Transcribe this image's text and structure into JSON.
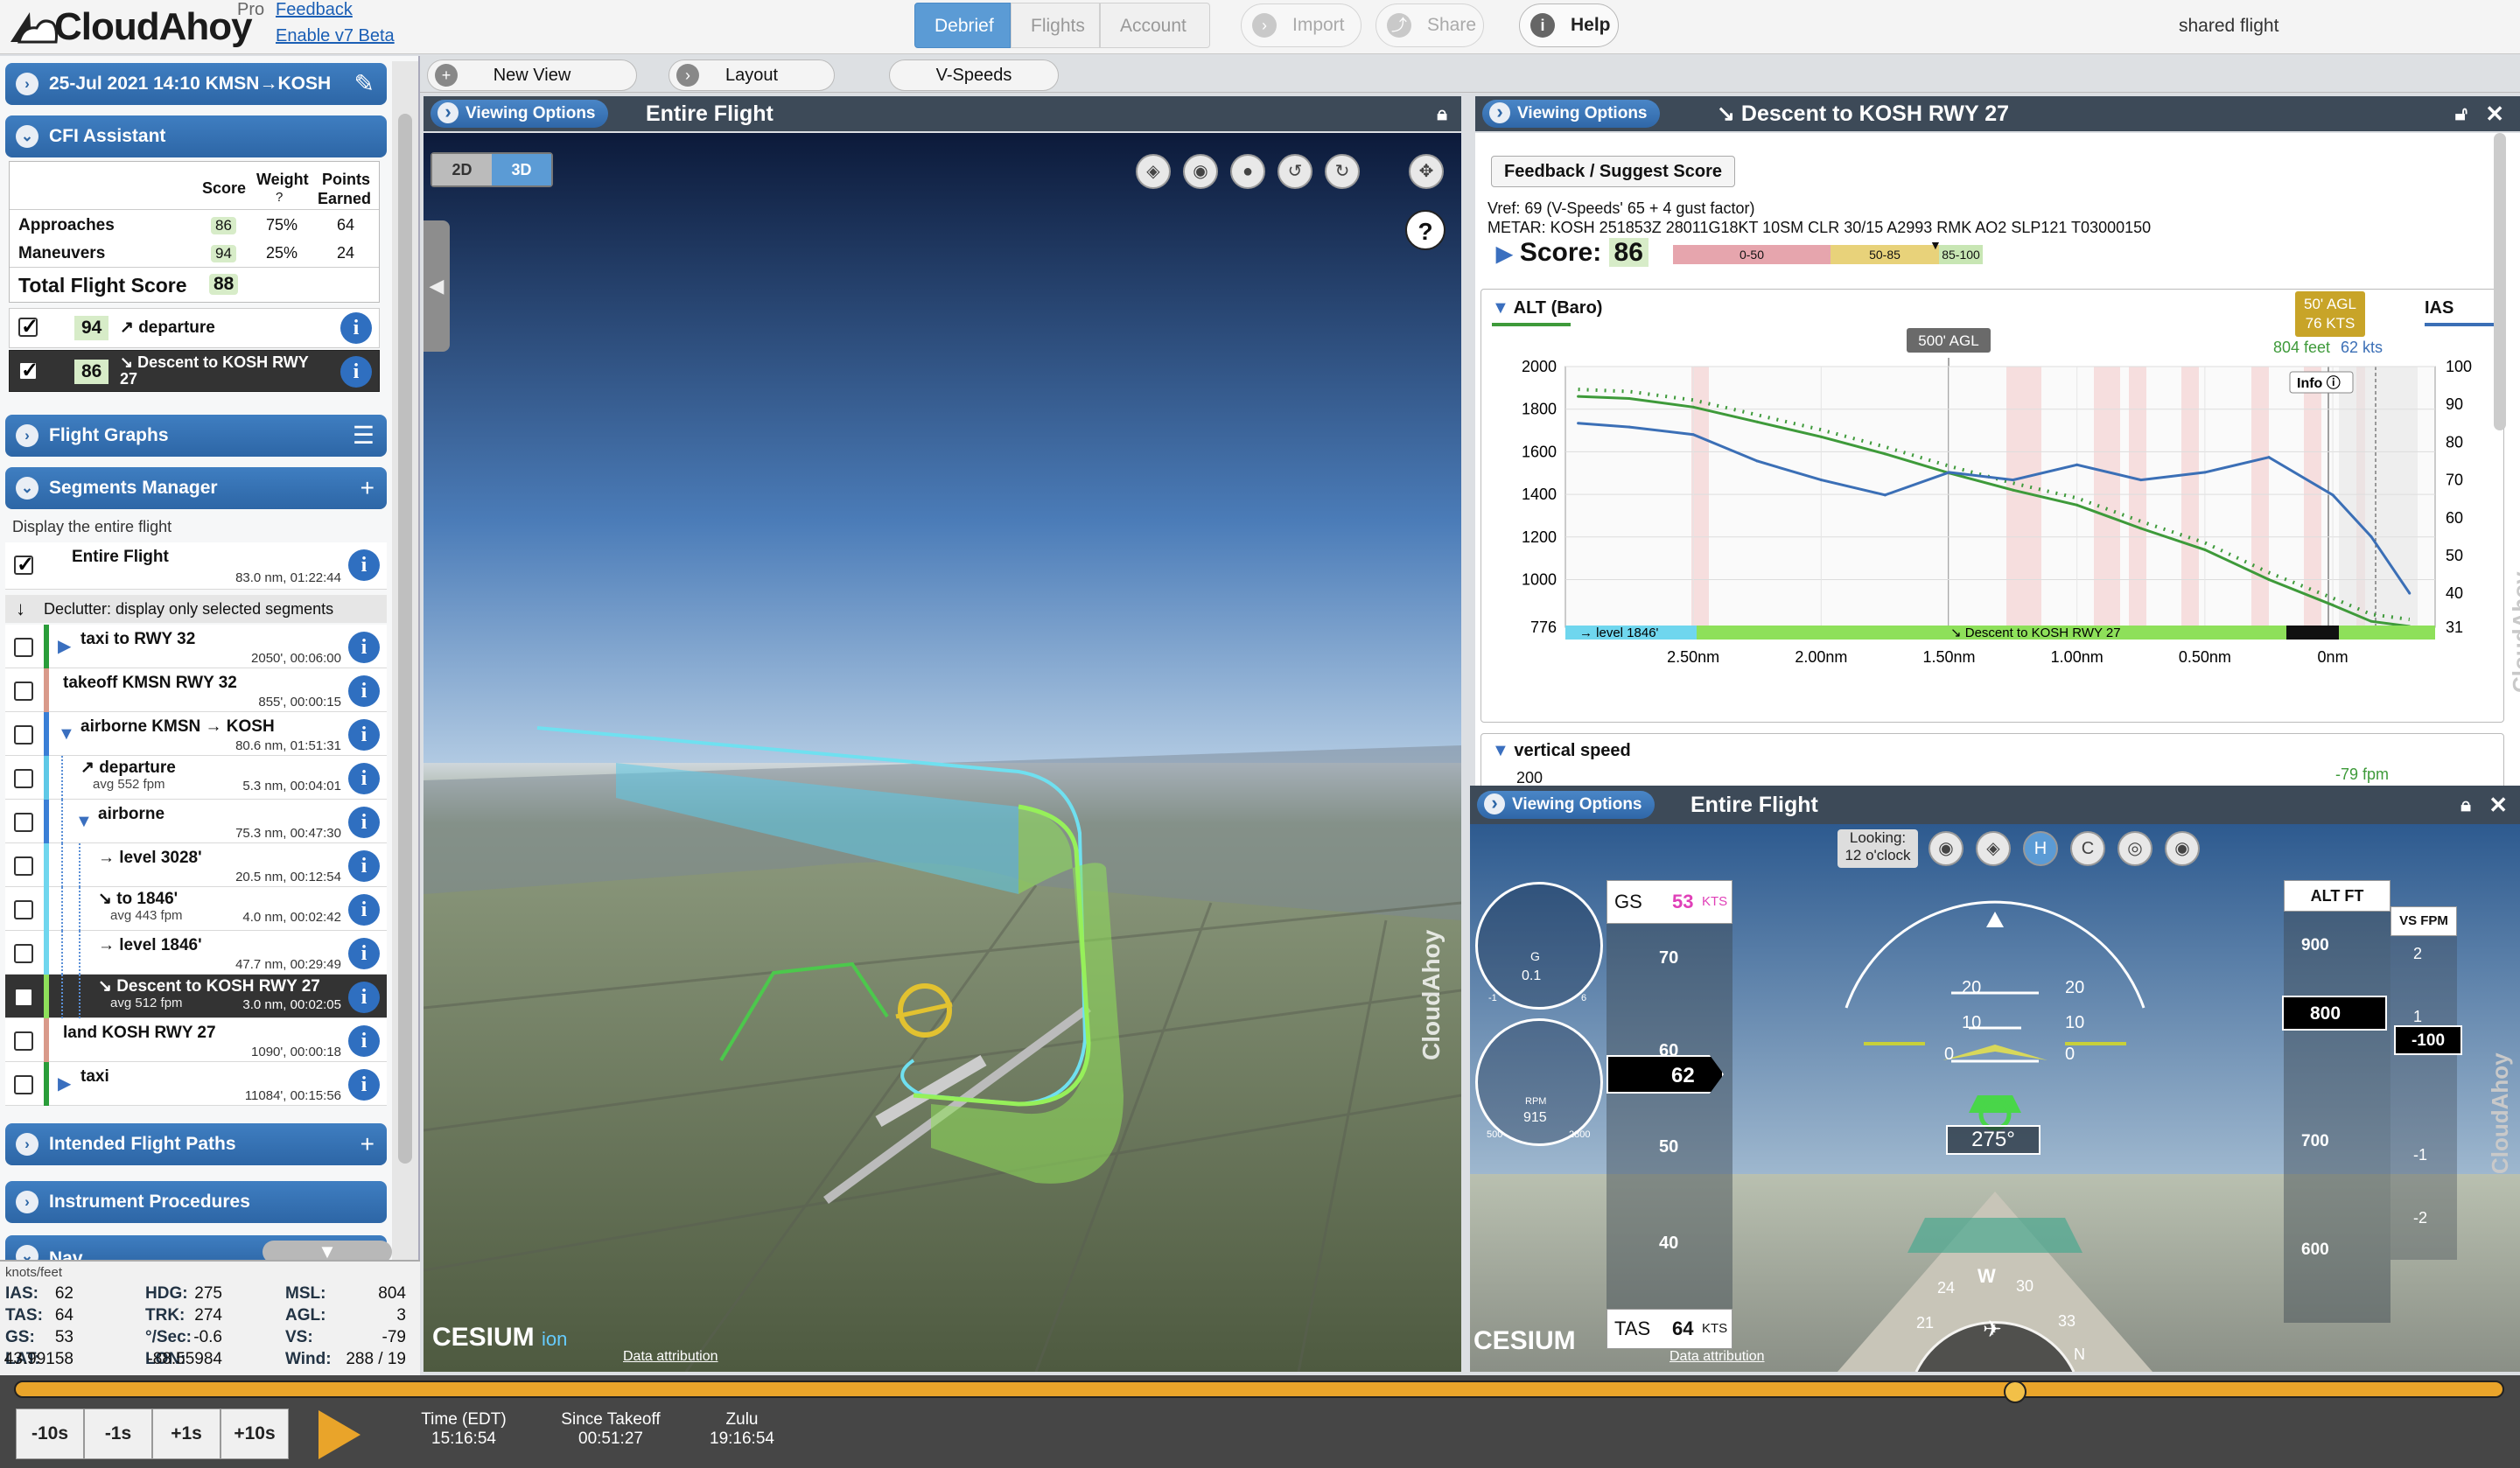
{
  "topbar": {
    "logo": "CloudAhoy",
    "pro": "Pro",
    "feedback": "Feedback",
    "beta": "Enable v7 Beta",
    "tabs": [
      "Debrief",
      "Flights",
      "Account"
    ],
    "import": "Import",
    "share": "Share",
    "help": "Help",
    "shared": "shared flight"
  },
  "flight": {
    "title": "25-Jul 2021 14:10  KMSN→KOSH"
  },
  "cfi": {
    "title": "CFI Assistant",
    "h_score": "Score",
    "h_weight": "Weight",
    "h_points": "Points",
    "h_earned": "Earned",
    "rows": [
      {
        "name": "Approaches",
        "score": "86",
        "weight": "75%",
        "points": "64"
      },
      {
        "name": "Maneuvers",
        "score": "94",
        "weight": "25%",
        "points": "24"
      }
    ],
    "total_label": "Total Flight Score",
    "total": "88",
    "items": [
      {
        "score": "94",
        "label": "↗ departure"
      },
      {
        "score": "86",
        "label": "↘ Descent to KOSH RWY 27"
      }
    ]
  },
  "panels": {
    "graphs": "Flight Graphs",
    "segments": "Segments Manager",
    "display": "Display the entire flight",
    "entire": "Entire Flight",
    "entire_meta": "83.0 nm, 01:22:44",
    "declutter": "Declutter: display only selected segments",
    "intended": "Intended Flight Paths",
    "procedures": "Instrument Procedures",
    "nav": "Nav"
  },
  "segments": [
    {
      "name": "taxi to RWY 32",
      "sub": "",
      "meta": "2050', 00:06:00",
      "color": "#2a9d3a",
      "indent": 0,
      "tri": "▶"
    },
    {
      "name": "takeoff KMSN RWY 32",
      "sub": "",
      "meta": "855', 00:00:15",
      "color": "#d99a8a",
      "indent": 0,
      "tri": ""
    },
    {
      "name": "airborne KMSN → KOSH",
      "sub": "",
      "meta": "80.6 nm, 01:51:31",
      "color": "#3a7fd6",
      "indent": 0,
      "tri": "▼"
    },
    {
      "name": "↗ departure",
      "sub": "avg 552 fpm",
      "meta": "5.3 nm, 00:04:01",
      "color": "#5ec8e6",
      "indent": 1,
      "tri": ""
    },
    {
      "name": "airborne",
      "sub": "",
      "meta": "75.3 nm, 00:47:30",
      "color": "#3a7fd6",
      "indent": 1,
      "tri": "▼"
    },
    {
      "name": "→ level 3028'",
      "sub": "",
      "meta": "20.5 nm, 00:12:54",
      "color": "#6fd6ee",
      "indent": 2,
      "tri": ""
    },
    {
      "name": "↘ to 1846'",
      "sub": "avg 443 fpm",
      "meta": "4.0 nm, 00:02:42",
      "color": "#6fd6ee",
      "indent": 2,
      "tri": ""
    },
    {
      "name": "→ level 1846'",
      "sub": "",
      "meta": "47.7 nm, 00:29:49",
      "color": "#6fd6ee",
      "indent": 2,
      "tri": ""
    },
    {
      "name": "↘ Descent to KOSH RWY 27",
      "sub": "avg 512 fpm",
      "meta": "3.0 nm, 00:02:05",
      "color": "#8ee05a",
      "indent": 2,
      "tri": "",
      "dark": true
    },
    {
      "name": "land KOSH RWY 27",
      "sub": "",
      "meta": "1090', 00:00:18",
      "color": "#d99a8a",
      "indent": 0,
      "tri": ""
    },
    {
      "name": "taxi",
      "sub": "",
      "meta": "11084', 00:15:56",
      "color": "#2a9d3a",
      "indent": 0,
      "tri": "▶"
    }
  ],
  "nav": {
    "unit": "knots/feet",
    "rows": [
      [
        {
          "k": "IAS:",
          "v": "62"
        },
        {
          "k": "HDG:",
          "v": "275"
        },
        {
          "k": "MSL:",
          "v": "804"
        }
      ],
      [
        {
          "k": "TAS:",
          "v": "64"
        },
        {
          "k": "TRK:",
          "v": "274"
        },
        {
          "k": "AGL:",
          "v": "3"
        }
      ],
      [
        {
          "k": "GS:",
          "v": "53"
        },
        {
          "k": "°/Sec:",
          "v": "-0.6"
        },
        {
          "k": "VS:",
          "v": "-79"
        }
      ],
      [
        {
          "k": "LAT:",
          "v": "43.99158"
        },
        {
          "k": "LON:",
          "v": "-88.55984"
        },
        {
          "k": "Wind:",
          "v": "288 / 19"
        }
      ]
    ]
  },
  "viewtabs": {
    "newview": "New View",
    "layout": "Layout",
    "vspeeds": "V-Speeds"
  },
  "view3d": {
    "vo": "Viewing Options",
    "title": "Entire Flight",
    "d2": "2D",
    "d3": "3D",
    "help": "?",
    "cesium": "CESIUM",
    "ion": "ion",
    "attr": "Data attribution",
    "brand": "CloudAhoy"
  },
  "graph": {
    "vo": "Viewing Options",
    "title": "↘ Descent to KOSH RWY 27",
    "feedback": "Feedback / Suggest Score",
    "vref": "Vref: 69 (V-Speeds' 65 + 4 gust factor)",
    "metar": "METAR: KOSH 251853Z 28011G18KT 10SM CLR 30/15 A2993 RMK AO2 SLP121 T03000150",
    "score_label": "Score:",
    "score": "86",
    "bands": [
      "0-50",
      "50-85",
      "85-100"
    ],
    "alt_label": "ALT (Baro)",
    "ias_label": "IAS",
    "agl_tag": "500' AGL",
    "cursor_tag1": "50' AGL",
    "cursor_tag2": "76 KTS",
    "cursor_feet": "804 feet",
    "cursor_kts": "62 kts",
    "info": "Info",
    "seg1": "→ level 1846'",
    "seg2": "↘ Descent to KOSH RWY 27",
    "vs_label": "vertical speed",
    "vs_tick": "200",
    "vs_val": "-79 fpm",
    "brand": "CloudAhoy"
  },
  "chart_data": {
    "type": "line",
    "title": "ALT (Baro)",
    "xlabel": "",
    "ylabel": "",
    "x_ticks": [
      "2.50nm",
      "2.00nm",
      "1.50nm",
      "1.00nm",
      "0.50nm",
      "0nm"
    ],
    "y_ticks": [
      2000,
      1800,
      1600,
      1400,
      1200,
      1000,
      776
    ],
    "y2_ticks": [
      100,
      90,
      80,
      70,
      60,
      50,
      40,
      31
    ],
    "ylim": [
      776,
      2000
    ],
    "y2lim": [
      31,
      100
    ],
    "x": [
      2.95,
      2.75,
      2.5,
      2.25,
      2.0,
      1.75,
      1.5,
      1.25,
      1.0,
      0.75,
      0.5,
      0.25,
      0.0,
      -0.15,
      -0.3
    ],
    "series": [
      {
        "name": "ALT (Baro)",
        "color": "#3e9a3a",
        "axis": "left",
        "values": [
          1860,
          1850,
          1810,
          1740,
          1670,
          1590,
          1500,
          1420,
          1350,
          1240,
          1140,
          1000,
          880,
          804,
          780
        ]
      },
      {
        "name": "IAS",
        "color": "#3b6fb6",
        "axis": "right",
        "values": [
          85,
          84,
          82,
          75,
          70,
          66,
          72,
          70,
          74,
          70,
          72,
          76,
          66,
          55,
          40
        ]
      }
    ]
  },
  "pfd": {
    "vo": "Viewing Options",
    "title": "Entire Flight",
    "looking": "Looking:",
    "looking2": "12 o'clock",
    "gs_label": "GS",
    "gs": "53",
    "gs_unit": "KTS",
    "g_label": "G",
    "g_val": "0.1",
    "rpm_label": "RPM",
    "rpm": "915",
    "rpm_min": "500",
    "rpm_max": "2800",
    "g_min": "-1",
    "g_max": "6",
    "ias_ticks": [
      "70",
      "60",
      "50",
      "40"
    ],
    "ias": "62",
    "tas_label": "TAS",
    "tas": "64",
    "tas_unit": "KTS",
    "alt_label": "ALT FT",
    "vs_label": "VS FPM",
    "alt_ticks": [
      "900",
      "800",
      "700",
      "600"
    ],
    "alt": "800",
    "vs": "-100",
    "vs_ticks": [
      "2",
      "1",
      "-1",
      "-2"
    ],
    "heading": "275°",
    "pitch": [
      "20",
      "10",
      "0"
    ],
    "hsi": [
      "W",
      "30",
      "33",
      "24",
      "21",
      "N"
    ],
    "cesium": "CESIUM",
    "attr": "Data attribution",
    "brand": "CloudAhoy"
  },
  "bottom": {
    "m10": "-10s",
    "m1": "-1s",
    "p1": "+1s",
    "p10": "+10s",
    "t1": "Time (EDT)",
    "v1": "15:16:54",
    "t2": "Since Takeoff",
    "v2": "00:51:27",
    "t3": "Zulu",
    "v3": "19:16:54"
  }
}
